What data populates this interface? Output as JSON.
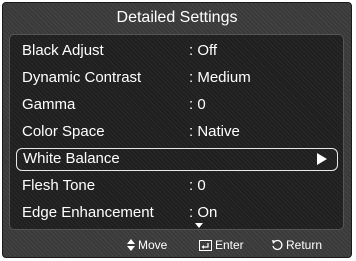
{
  "title": "Detailed Settings",
  "settings": [
    {
      "label": "Black Adjust",
      "value": ": Off"
    },
    {
      "label": "Dynamic Contrast",
      "value": ": Medium"
    },
    {
      "label": "Gamma",
      "value": ": 0"
    },
    {
      "label": "Color Space",
      "value": ": Native"
    },
    {
      "label": "White Balance",
      "value": ""
    },
    {
      "label": "Flesh Tone",
      "value": ": 0"
    },
    {
      "label": "Edge Enhancement",
      "value": ": On"
    }
  ],
  "selected_index": 4,
  "footer": {
    "move": "Move",
    "enter": "Enter",
    "return": "Return",
    "move_icon": "up-down-arrows-icon",
    "enter_icon": "enter-icon",
    "return_icon": "return-icon"
  }
}
